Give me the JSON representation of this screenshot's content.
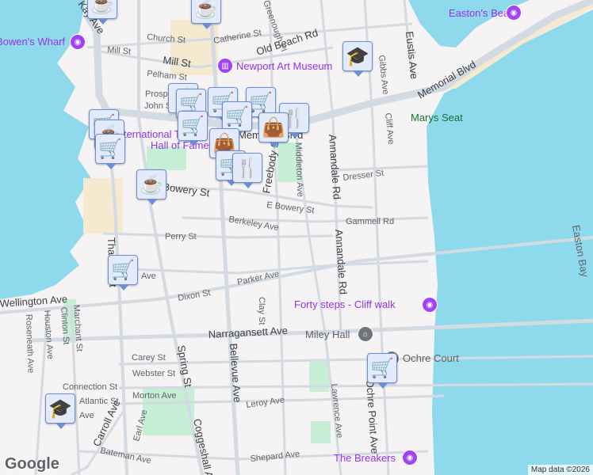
{
  "streets": [
    "Church St",
    "Catherine St",
    "Old Beach Rd",
    "Mill St",
    "Mill St",
    "Pelham St",
    "Prospect",
    "John St",
    "Memorial Blvd",
    "Bowery St",
    "E Bowery St",
    "Berkeley Ave",
    "Perry St",
    "Parker Ave",
    "Dixon St",
    "Wellington Ave",
    "Narragansett Ave",
    "Carey St",
    "Webster St",
    "Connection St",
    "Morton Ave",
    "Leroy Ave",
    "Shepard Ave",
    "Bateman Ave",
    "Carroll Ave",
    "Spring St",
    "Bellevue Ave",
    "Coggeshall Ave",
    "Clay St",
    "Freebody St",
    "Middleton Ave",
    "Annandale Rd",
    "Annandale Rd",
    "Dresser St",
    "Gammell Rd",
    "Gibbs Ave",
    "Eustis Ave",
    "Cliff Ave",
    "Lawrence Ave",
    "Ochre Point Ave",
    "Thames St",
    "Roseneath Ave",
    "Houston Ave",
    "Clinton St",
    "Marchant St",
    "Earl Ave",
    "Atlantic St",
    "Memorial Blvd",
    "Kay Ave",
    "Greenough Pl",
    "Ave",
    "Ave",
    "Easton Bay"
  ],
  "pois": {
    "bowens_wharf": "Bowen's Wharf",
    "art_museum": "Newport Art Museum",
    "hall_of_fame_1": "International Tennis",
    "hall_of_fame_2": "Hall of Fame",
    "eastons_beach": "Easton's Beach",
    "marys_seat": "Marys Seat",
    "forty_steps": "Forty steps - Cliff walk",
    "miley_hall": "Miley Hall",
    "ochre_court": "Ochre Court",
    "the_breakers": "The Breakers"
  },
  "markers": [
    "coffee",
    "coffee",
    "school",
    "restaurant",
    "shopping-cart",
    "shopping-cart",
    "shopping-cart",
    "restaurant",
    "shopping-bag",
    "shopping-cart",
    "shopping-cart",
    "shopping-bag",
    "shopping-cart",
    "restaurant",
    "shopping-cart",
    "coffee",
    "shopping-cart",
    "coffee",
    "shopping-cart",
    "shopping-cart",
    "school"
  ],
  "footer": {
    "logo": "Google",
    "attribution": "Map data ©2026"
  },
  "colors": {
    "water": "#8fd9ec",
    "land": "#f5f3f3",
    "park": "#c6efd6",
    "road": "#d3dae2",
    "marker_bg": "#e3ebfa",
    "marker_icon": "#0d3e63",
    "poi": "#9334e6"
  }
}
